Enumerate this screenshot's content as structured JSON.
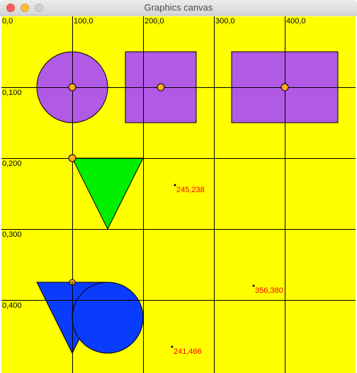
{
  "window": {
    "title": "Graphics canvas",
    "buttons": {
      "close": "close-icon",
      "minimize": "minimize-icon",
      "maximize": "maximize-icon"
    }
  },
  "colors": {
    "background": "#ffff00",
    "grid": "#000000",
    "purple": "#b15ae6",
    "green": "#00ee00",
    "blue": "#0a3cff",
    "orange_dot": "#ffaa22",
    "annotation": "#ff0000"
  },
  "grid_labels": {
    "x0": "0,0",
    "x100": "100,0",
    "x200": "200,0",
    "x300": "300,0",
    "x400": "400,0",
    "y100": "0,100",
    "y200": "0,200",
    "y300": "0,300",
    "y400": "0,400"
  },
  "annotations": {
    "a1": "245,238",
    "a2": "356,380",
    "a3": "241,466"
  },
  "anchor_marker": "x"
}
